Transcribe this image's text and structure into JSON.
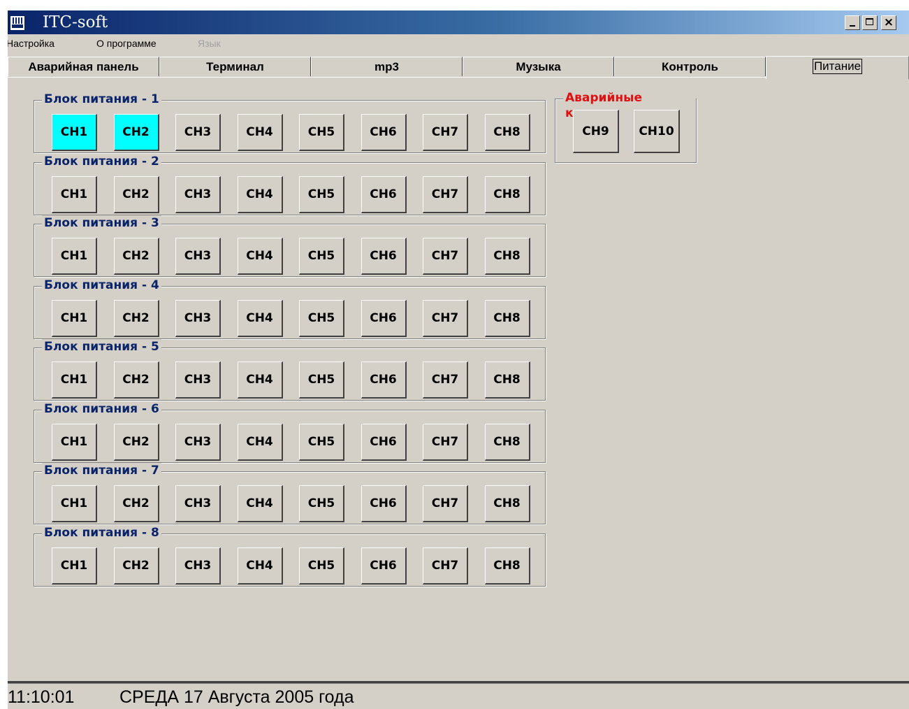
{
  "window": {
    "title": "ITC-soft"
  },
  "menu": [
    {
      "label": "Настройка",
      "enabled": true
    },
    {
      "label": "О программе",
      "enabled": true
    },
    {
      "label": "Язык",
      "enabled": false
    }
  ],
  "tabs": [
    {
      "label": "Аварийная панель",
      "active": false
    },
    {
      "label": "Терминал",
      "active": false
    },
    {
      "label": "mp3",
      "active": false
    },
    {
      "label": "Музыка",
      "active": false
    },
    {
      "label": "Контроль",
      "active": false
    },
    {
      "label": "Питание",
      "active": true
    }
  ],
  "power_blocks": [
    {
      "title": "Блок питания - 1",
      "channels": [
        {
          "label": "CH1",
          "on": true
        },
        {
          "label": "CH2",
          "on": true
        },
        {
          "label": "CH3",
          "on": false
        },
        {
          "label": "CH4",
          "on": false
        },
        {
          "label": "CH5",
          "on": false
        },
        {
          "label": "CH6",
          "on": false
        },
        {
          "label": "CH7",
          "on": false
        },
        {
          "label": "CH8",
          "on": false
        }
      ]
    },
    {
      "title": "Блок питания - 2",
      "channels": [
        {
          "label": "CH1",
          "on": false
        },
        {
          "label": "CH2",
          "on": false
        },
        {
          "label": "CH3",
          "on": false
        },
        {
          "label": "CH4",
          "on": false
        },
        {
          "label": "CH5",
          "on": false
        },
        {
          "label": "CH6",
          "on": false
        },
        {
          "label": "CH7",
          "on": false
        },
        {
          "label": "CH8",
          "on": false
        }
      ]
    },
    {
      "title": "Блок питания - 3",
      "channels": [
        {
          "label": "CH1",
          "on": false
        },
        {
          "label": "CH2",
          "on": false
        },
        {
          "label": "CH3",
          "on": false
        },
        {
          "label": "CH4",
          "on": false
        },
        {
          "label": "CH5",
          "on": false
        },
        {
          "label": "CH6",
          "on": false
        },
        {
          "label": "CH7",
          "on": false
        },
        {
          "label": "CH8",
          "on": false
        }
      ]
    },
    {
      "title": "Блок питания - 4",
      "channels": [
        {
          "label": "CH1",
          "on": false
        },
        {
          "label": "CH2",
          "on": false
        },
        {
          "label": "CH3",
          "on": false
        },
        {
          "label": "CH4",
          "on": false
        },
        {
          "label": "CH5",
          "on": false
        },
        {
          "label": "CH6",
          "on": false
        },
        {
          "label": "CH7",
          "on": false
        },
        {
          "label": "CH8",
          "on": false
        }
      ]
    },
    {
      "title": "Блок питания - 5",
      "channels": [
        {
          "label": "CH1",
          "on": false
        },
        {
          "label": "CH2",
          "on": false
        },
        {
          "label": "CH3",
          "on": false
        },
        {
          "label": "CH4",
          "on": false
        },
        {
          "label": "CH5",
          "on": false
        },
        {
          "label": "CH6",
          "on": false
        },
        {
          "label": "CH7",
          "on": false
        },
        {
          "label": "CH8",
          "on": false
        }
      ]
    },
    {
      "title": "Блок питания - 6",
      "channels": [
        {
          "label": "CH1",
          "on": false
        },
        {
          "label": "CH2",
          "on": false
        },
        {
          "label": "CH3",
          "on": false
        },
        {
          "label": "CH4",
          "on": false
        },
        {
          "label": "CH5",
          "on": false
        },
        {
          "label": "CH6",
          "on": false
        },
        {
          "label": "CH7",
          "on": false
        },
        {
          "label": "CH8",
          "on": false
        }
      ]
    },
    {
      "title": "Блок питания - 7",
      "channels": [
        {
          "label": "CH1",
          "on": false
        },
        {
          "label": "CH2",
          "on": false
        },
        {
          "label": "CH3",
          "on": false
        },
        {
          "label": "CH4",
          "on": false
        },
        {
          "label": "CH5",
          "on": false
        },
        {
          "label": "CH6",
          "on": false
        },
        {
          "label": "CH7",
          "on": false
        },
        {
          "label": "CH8",
          "on": false
        }
      ]
    },
    {
      "title": "Блок питания - 8",
      "channels": [
        {
          "label": "CH1",
          "on": false
        },
        {
          "label": "CH2",
          "on": false
        },
        {
          "label": "CH3",
          "on": false
        },
        {
          "label": "CH4",
          "on": false
        },
        {
          "label": "CH5",
          "on": false
        },
        {
          "label": "CH6",
          "on": false
        },
        {
          "label": "CH7",
          "on": false
        },
        {
          "label": "CH8",
          "on": false
        }
      ]
    }
  ],
  "emergency": {
    "title": "Аварийные каналы",
    "channels": [
      {
        "label": "CH9",
        "on": false
      },
      {
        "label": "CH10",
        "on": false
      }
    ]
  },
  "status": {
    "time": "11:10:01",
    "date": "СРЕДА 17 Августа 2005 года"
  },
  "colors": {
    "channel_on": "#00ffff",
    "group_title": "#0a246a",
    "emergency_title": "#e01010",
    "face": "#d4d0c8"
  }
}
